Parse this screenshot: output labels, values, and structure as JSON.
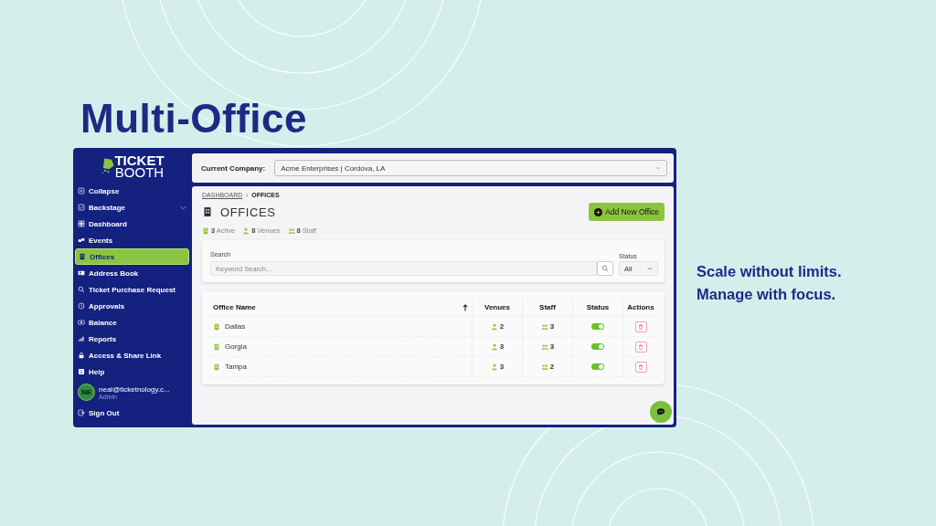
{
  "slide": {
    "title": "Multi-Office",
    "taglines": [
      "Scale without limits.",
      "Manage with focus."
    ]
  },
  "sidebar": {
    "logo": [
      "TICKET",
      "BOOTH"
    ],
    "items": [
      {
        "label": "Collapse",
        "kind": "link",
        "selected": false
      },
      {
        "label": "Backstage",
        "kind": "group",
        "selected": false
      },
      {
        "label": "Dashboard",
        "kind": "link",
        "selected": false
      },
      {
        "label": "Events",
        "kind": "link",
        "selected": false
      },
      {
        "label": "Offices",
        "kind": "link",
        "selected": true
      },
      {
        "label": "Address Book",
        "kind": "link",
        "selected": false
      },
      {
        "label": "Ticket Purchase Request",
        "kind": "link",
        "selected": false
      },
      {
        "label": "Approvals",
        "kind": "link",
        "selected": false
      },
      {
        "label": "Balance",
        "kind": "link",
        "selected": false
      },
      {
        "label": "Reports",
        "kind": "link",
        "selected": false
      },
      {
        "label": "Access & Share Link",
        "kind": "link",
        "selected": false
      },
      {
        "label": "Help",
        "kind": "link",
        "selected": false
      }
    ],
    "user": {
      "initials": "NE",
      "email": "neal@ticketnology.c...",
      "role": "Admin"
    },
    "sign_out": "Sign Out"
  },
  "header": {
    "label": "Current Company:",
    "value": "Acme Enterprises | Cordova, LA"
  },
  "page": {
    "breadcrumb": [
      "DASHBOARD",
      "OFFICES"
    ],
    "title": "OFFICES",
    "add_button": "Add New Office",
    "stats": [
      "**3** Active",
      "**8** Venues",
      "**8** Staff"
    ]
  },
  "search": {
    "label": "Search",
    "placeholder": "Keyword Search...",
    "status_label": "Status",
    "status_value": "All"
  },
  "table": {
    "columns": [
      {
        "label": "Office Name",
        "sorted": true
      },
      {
        "label": "Venues",
        "sorted": false
      },
      {
        "label": "Staff",
        "sorted": false
      },
      {
        "label": "Status",
        "sorted": false
      },
      {
        "label": "Actions",
        "sorted": false
      }
    ],
    "rows": [
      {
        "name": "Dallas",
        "venues": "2",
        "staff": "3",
        "active": true
      },
      {
        "name": "Gorgia",
        "venues": "3",
        "staff": "3",
        "active": true
      },
      {
        "name": "Tampa",
        "venues": "3",
        "staff": "2",
        "active": true
      }
    ]
  }
}
